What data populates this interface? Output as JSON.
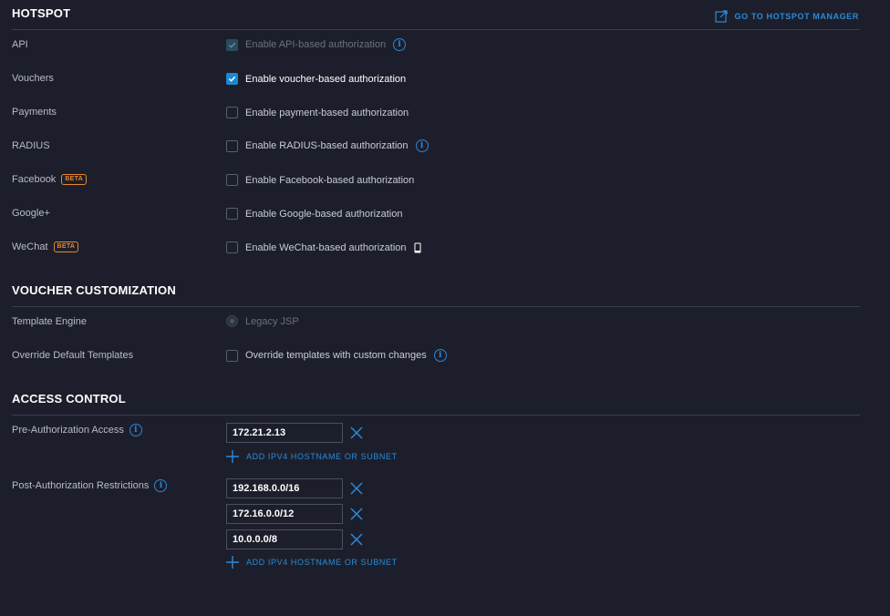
{
  "hotspot": {
    "title": "HOTSPOT",
    "manager_link": "GO TO HOTSPOT MANAGER",
    "rows": [
      {
        "label": "API",
        "option": "Enable API-based authorization",
        "checked": true,
        "disabled": true
      },
      {
        "label": "Vouchers",
        "option": "Enable voucher-based authorization",
        "checked": true,
        "disabled": false
      },
      {
        "label": "Payments",
        "option": "Enable payment-based authorization",
        "checked": false,
        "disabled": false
      },
      {
        "label": "RADIUS",
        "option": "Enable RADIUS-based authorization",
        "checked": false,
        "disabled": false
      },
      {
        "label": "Facebook",
        "badge": "BETA",
        "option": "Enable Facebook-based authorization",
        "checked": false,
        "disabled": false
      },
      {
        "label": "Google+",
        "option": "Enable Google-based authorization",
        "checked": false,
        "disabled": false
      },
      {
        "label": "WeChat",
        "badge": "BETA",
        "option": "Enable WeChat-based authorization",
        "checked": false,
        "disabled": false
      }
    ]
  },
  "voucher": {
    "title": "VOUCHER CUSTOMIZATION",
    "template_engine_label": "Template Engine",
    "template_engine_value": "Legacy JSP",
    "override_label": "Override Default Templates",
    "override_option": "Override templates with custom changes"
  },
  "access": {
    "title": "ACCESS CONTROL",
    "pre_label": "Pre-Authorization Access",
    "pre_entries": [
      "172.21.2.13"
    ],
    "post_label": "Post-Authorization Restrictions",
    "post_entries": [
      "192.168.0.0/16",
      "172.16.0.0/12",
      "10.0.0.0/8"
    ],
    "add_label": "ADD IPV4 HOSTNAME OR SUBNET"
  },
  "colors": {
    "background": "#1c1f2b",
    "accent": "#1a8ad4",
    "beta": "#e5872e"
  }
}
